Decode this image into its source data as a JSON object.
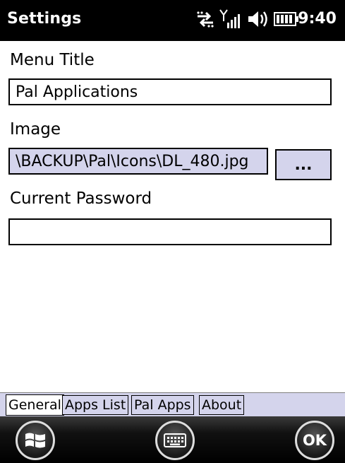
{
  "titlebar": {
    "title": "Settings",
    "time": "9:40",
    "icons": [
      "data-transfer-icon",
      "signal-strength-icon",
      "speaker-icon",
      "battery-icon"
    ]
  },
  "form": {
    "menu_title_label": "Menu Title",
    "menu_title_value": "Pal Applications",
    "image_label": "Image",
    "image_value": "\\BACKUP\\Pal\\Icons\\DL_480.jpg",
    "browse_label": "...",
    "password_label": "Current Password",
    "password_value": ""
  },
  "tabs": [
    {
      "label": "General",
      "active": true
    },
    {
      "label": "Apps List",
      "active": false
    },
    {
      "label": "Pal Apps",
      "active": false
    },
    {
      "label": "About",
      "active": false
    }
  ],
  "appbar": {
    "buttons": [
      "windows-start-icon",
      "keyboard-icon",
      "ok-icon"
    ],
    "ok_label": "OK"
  },
  "colors": {
    "selection": "#d4d4ec",
    "titlebar": "#000000"
  }
}
